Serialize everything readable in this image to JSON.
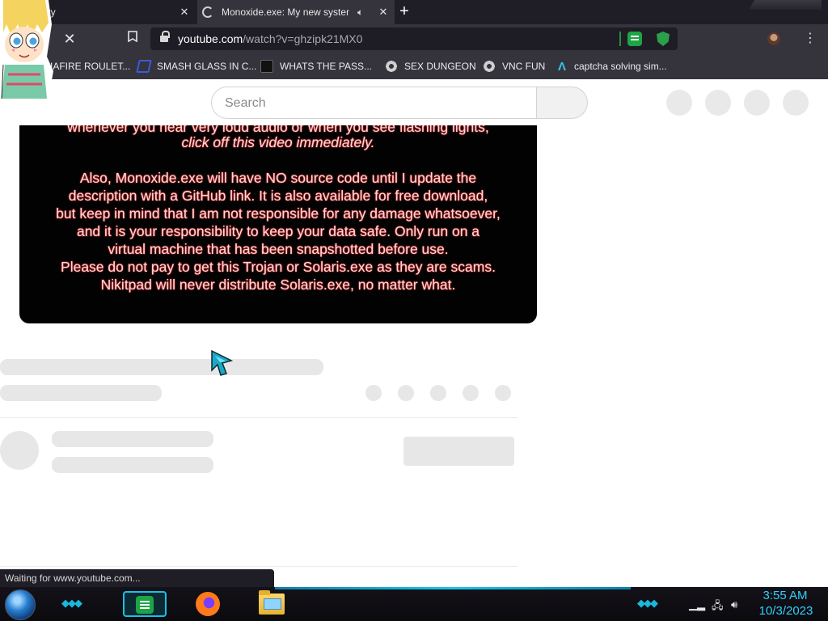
{
  "tabs": [
    {
      "label": "istory",
      "active": false
    },
    {
      "label": "Monoxide.exe: My new system",
      "active": true
    }
  ],
  "address_bar": {
    "host": "youtube.com",
    "path": "/watch?v=ghzipk21MX0"
  },
  "bookmarks": [
    {
      "label": "IAFIRE ROULET...",
      "icon": "bookmark-icon"
    },
    {
      "label": "SMASH GLASS IN C...",
      "icon": "blue-logo-icon"
    },
    {
      "label": "WHATS THE PASS...",
      "icon": "dark-logo-icon"
    },
    {
      "label": "SEX DUNGEON",
      "icon": "gear-icon"
    },
    {
      "label": "VNC FUN",
      "icon": "gear-icon"
    },
    {
      "label": "captcha solving sim...",
      "icon": "a-logo-icon"
    }
  ],
  "youtube": {
    "search_placeholder": "Search"
  },
  "video_text": {
    "line_partial": "whenever you hear very loud audio or when you see flashing lights,",
    "line_italic": "click off this video immediately.",
    "lines": [
      "Also, Monoxide.exe will have NO source code until I update the",
      "description with a GitHub link. It is also available for free download,",
      "but keep in mind that I am not responsible for any damage whatsoever,",
      "and it is your responsibility to keep your data safe. Only run on a",
      "virtual machine that has been snapshotted before use.",
      "Please do not pay to get this Trojan or Solaris.exe as they are scams.",
      "Nikitpad will never distribute Solaris.exe, no matter what."
    ]
  },
  "status_bar": {
    "text": "Waiting for www.youtube.com..."
  },
  "taskbar": {
    "time": "3:55 AM",
    "date": "10/3/2023"
  },
  "colors": {
    "chrome_dark": "#1f1d26",
    "chrome_mid": "#35333c",
    "accent_cyan": "#2fd0ff",
    "video_text": "#ffd6d6"
  }
}
